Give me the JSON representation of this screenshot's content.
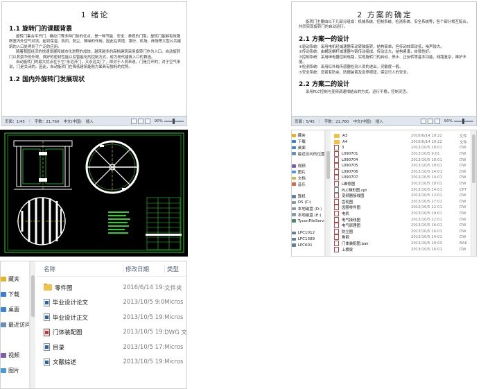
{
  "doc1": {
    "heading": "1  绪论",
    "section1": "1.1 旋转门的课题背景",
    "paragraphs": [
      "旋转门集合平开门、推拉门等多种门体的优点，是一种节能、安全、美观的门型。旋转门能够有效隔断室内外空气对流，起到保温、防风、防尘、降噪的作用，因此在宾馆、银行、机场、商场等大型公共建筑的入口处得到了广泛的应用。",
      "随着我国经济的快速发展和城市化进程的加快，越来越多的高档建筑采用旋转门作为入口。自动旋转门以其豪华的外观、良好的密封性能以及智能化的控制方式，成为现代建筑入口的首选。",
      "自动旋转门的最大优点在于它“永远开门，又永远关门”，即对于人员来说，门是打开的；对于空气来说，门是关闭的。因此，自动旋转门在降低建筑能耗方面具有独特的优势。"
    ],
    "section2": "1.2 国内外旋转门发展现状",
    "status": {
      "page": "页面：1/45",
      "words": "字数：21,760",
      "lang": "中文(中国)",
      "mode": "插入",
      "zoom": "90%"
    }
  },
  "doc2": {
    "heading": "2  方案的确定",
    "intro": "旋转门主要由以下几部分组成：机械系统、控制系统、检测系统、安全系统等，各个部分相互配合，共同实现旋转门的自动运行。",
    "section1": "2.1 方案一的设计",
    "items": [
      "①驱动系统：采用电机经减速器带动转轴旋转，结构简单，但传动效率较低，噪声较大。",
      "②传动系统：由蜗轮蜗杆减速器与链传动组成，传动比大，结构紧凑，自锁性好。",
      "③控制系统：采用继电器控制电路，实现旋转门的启动、停止、正反转等基本功能，线路复杂，维护不便。",
      "④检测系统：采用红外线传感器检测人员的进出，灵敏度一般。",
      "⑤安全系统：设置有防夹、防撞装置及急停按钮，保证行人的安全。"
    ],
    "section2": "2.2 方案二的设计",
    "section2_text": "采用PLC控制与变频调速相结合的方式，运行平稳，控制灵活。",
    "status": {
      "page": "页面：5/45",
      "words": "字数：21,760",
      "lang": "中文(中国)",
      "mode": "插入",
      "zoom": "90%"
    }
  },
  "explorer1": {
    "nav": [
      {
        "label": "藏夹",
        "icon": "star-icon"
      },
      {
        "label": "下载",
        "icon": "download-icon"
      },
      {
        "label": "桌面",
        "icon": "desktop-icon"
      },
      {
        "label": "最近访问的位置",
        "icon": "recent-icon"
      },
      {
        "label": "",
        "icon": ""
      },
      {
        "label": "视频",
        "icon": "video-icon"
      },
      {
        "label": "图片",
        "icon": "picture-icon"
      },
      {
        "label": "文档",
        "icon": "document-icon"
      },
      {
        "label": "音乐",
        "icon": "music-icon"
      },
      {
        "label": "",
        "icon": ""
      },
      {
        "label": "算机",
        "icon": "computer-icon"
      },
      {
        "label": "OS (C:)",
        "icon": "drive-icon"
      },
      {
        "label": "本地磁盘 (D:)",
        "icon": "drive-icon"
      },
      {
        "label": "本地磁盘 (E:)",
        "icon": "drive-icon"
      },
      {
        "label": "TyconFileServer",
        "icon": "network-drive-icon"
      },
      {
        "label": "",
        "icon": ""
      },
      {
        "label": "LPC1012",
        "icon": "computer-icon"
      },
      {
        "label": "LPC1389",
        "icon": "computer-icon"
      },
      {
        "label": "LPC601",
        "icon": "computer-icon"
      }
    ],
    "files": [
      {
        "name": "A3",
        "date": "2016/6/14 19:22",
        "type": "文件",
        "icon": "folder"
      },
      {
        "name": "A4",
        "date": "2016/6/14 19:22",
        "type": "文件",
        "icon": "folder"
      },
      {
        "name": "3",
        "date": "2013/10/5 18:01",
        "type": "DW",
        "icon": "dwg"
      },
      {
        "name": "L090701",
        "date": "2013/10/5 9:01",
        "type": "DW",
        "icon": "dwg"
      },
      {
        "name": "L090704",
        "date": "2013/10/5 18:01",
        "type": "DW",
        "icon": "dwg"
      },
      {
        "name": "L090705",
        "date": "2013/10/5 18:01",
        "type": "DW",
        "icon": "dwg"
      },
      {
        "name": "L090706",
        "date": "2013/10/5 14:01",
        "type": "DW",
        "icon": "dwg"
      },
      {
        "name": "L090707",
        "date": "2013/10/5 14:01",
        "type": "DW",
        "icon": "dwg"
      },
      {
        "name": "L维修图",
        "date": "2013/10/5 18:01",
        "type": "DW",
        "icon": "dwg"
      },
      {
        "name": "PLC梯形图.cpt",
        "date": "2013/10/5 14:01",
        "type": "CPT",
        "icon": "doc"
      },
      {
        "name": "变频器接线图",
        "date": "2013/10/5 12:01",
        "type": "DW",
        "icon": "dwg"
      },
      {
        "name": "齿轮图",
        "date": "2013/10/5 17:01",
        "type": "DW",
        "icon": "dwg"
      },
      {
        "name": "齿圈零件图",
        "date": "2013/10/5 12:01",
        "type": "DW",
        "icon": "dwg"
      },
      {
        "name": "电机",
        "date": "2013/10/5 19:01",
        "type": "DW",
        "icon": "dwg"
      },
      {
        "name": "电气接线图",
        "date": "2013/10/5 12:01",
        "type": "DW",
        "icon": "dwg"
      },
      {
        "name": "电气原理图",
        "date": "2013/10/5 16:01",
        "type": "DW",
        "icon": "dwg"
      },
      {
        "name": "防尘圈",
        "date": "2013/10/5 16:01",
        "type": "DW",
        "icon": "dwg"
      },
      {
        "name": "角钢",
        "date": "2013/10/5 14:01",
        "type": "DW",
        "icon": "dwg"
      },
      {
        "name": "门体装配图.bak",
        "date": "2013/10/5 19:03",
        "type": "BAK",
        "icon": "dwg"
      },
      {
        "name": "上横梁",
        "date": "2013/10/5 16:01",
        "type": "DW",
        "icon": "dwg"
      }
    ]
  },
  "explorer2": {
    "nav": [
      {
        "label": "藏夹",
        "icon": "star-icon"
      },
      {
        "label": "下载",
        "icon": "download-icon"
      },
      {
        "label": "桌面",
        "icon": "desktop-icon"
      },
      {
        "label": "最近访问的位置",
        "icon": "recent-icon"
      },
      {
        "label": "",
        "icon": ""
      },
      {
        "label": "视频",
        "icon": "video-icon"
      },
      {
        "label": "图片",
        "icon": "picture-icon"
      }
    ],
    "columns": {
      "name": "名称",
      "date": "修改日期",
      "type": "类型"
    },
    "files": [
      {
        "name": "零件图",
        "date": "2016/6/14 19:22",
        "type": "文件夹",
        "icon": "folder"
      },
      {
        "name": "毕业设计论文",
        "date": "2013/10/5 9:01",
        "type": "Micros",
        "icon": "doc"
      },
      {
        "name": "毕业设计正文",
        "date": "2013/10/5 19:01",
        "type": "Micros",
        "icon": "doc"
      },
      {
        "name": "门体装配图",
        "date": "2013/10/5 19:01",
        "type": "DWG 文",
        "icon": "dwg"
      },
      {
        "name": "目录",
        "date": "2013/10/5 17:01",
        "type": "Micros",
        "icon": "doc"
      },
      {
        "name": "文献综述",
        "date": "2013/10/5 19:01",
        "type": "Micros",
        "icon": "doc"
      }
    ]
  },
  "colors": {
    "cad_green": "#2bd42b",
    "cad_white": "#ffffff",
    "cad_yellow": "#f0e000",
    "folder": "#f0c24a"
  }
}
